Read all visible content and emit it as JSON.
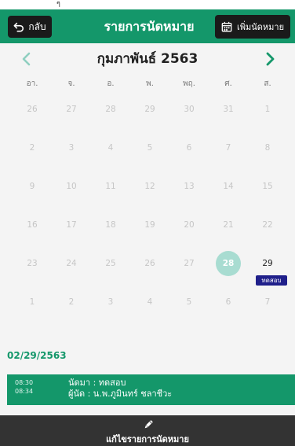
{
  "status": {
    "mark": "ๆ"
  },
  "header": {
    "back_label": "กลับ",
    "title": "รายการนัดหมาย",
    "add_label": "เพิ่มนัดหมาย"
  },
  "calendar": {
    "month_title": "กุมภาพันธ์ 2563",
    "weekdays": [
      "อา.",
      "จ.",
      "อ.",
      "พ.",
      "พฤ.",
      "ศ.",
      "ส."
    ],
    "weeks": [
      [
        {
          "d": "26",
          "active": false
        },
        {
          "d": "27",
          "active": false
        },
        {
          "d": "28",
          "active": false
        },
        {
          "d": "29",
          "active": false
        },
        {
          "d": "30",
          "active": false
        },
        {
          "d": "31",
          "active": false
        },
        {
          "d": "1",
          "active": false
        }
      ],
      [
        {
          "d": "2",
          "active": false
        },
        {
          "d": "3",
          "active": false
        },
        {
          "d": "4",
          "active": false
        },
        {
          "d": "5",
          "active": false
        },
        {
          "d": "6",
          "active": false
        },
        {
          "d": "7",
          "active": false
        },
        {
          "d": "8",
          "active": false
        }
      ],
      [
        {
          "d": "9",
          "active": false
        },
        {
          "d": "10",
          "active": false
        },
        {
          "d": "11",
          "active": false
        },
        {
          "d": "12",
          "active": false
        },
        {
          "d": "13",
          "active": false
        },
        {
          "d": "14",
          "active": false
        },
        {
          "d": "15",
          "active": false
        }
      ],
      [
        {
          "d": "16",
          "active": false
        },
        {
          "d": "17",
          "active": false
        },
        {
          "d": "18",
          "active": false
        },
        {
          "d": "19",
          "active": false
        },
        {
          "d": "20",
          "active": false
        },
        {
          "d": "21",
          "active": false
        },
        {
          "d": "22",
          "active": false
        }
      ],
      [
        {
          "d": "23",
          "active": false
        },
        {
          "d": "24",
          "active": false
        },
        {
          "d": "25",
          "active": false
        },
        {
          "d": "26",
          "active": false
        },
        {
          "d": "27",
          "active": false
        },
        {
          "d": "28",
          "active": true,
          "selected": true
        },
        {
          "d": "29",
          "active": true,
          "event": "ทดสอบ"
        }
      ],
      [
        {
          "d": "1",
          "active": false
        },
        {
          "d": "2",
          "active": false
        },
        {
          "d": "3",
          "active": false
        },
        {
          "d": "4",
          "active": false
        },
        {
          "d": "5",
          "active": false
        },
        {
          "d": "6",
          "active": false
        },
        {
          "d": "7",
          "active": false
        }
      ]
    ]
  },
  "selected_date": "02/29/2563",
  "appointment": {
    "start": "08:30",
    "end": "08:34",
    "title": "นัดมา : ทดสอบ",
    "owner": "ผู้นัด : น.พ.ภูมินทร์ ชลาชีวะ"
  },
  "footer": {
    "label": "แก้ไขรายการนัดหมาย"
  },
  "colors": {
    "primary": "#14976a",
    "dark_button": "#1a1a1a",
    "selected_day": "#a8dcd1",
    "event_badge": "#1f1f8a",
    "footer": "#333333"
  },
  "icons": {
    "back": "undo-arrow-icon",
    "add": "calendar-icon",
    "prev": "chevron-left-icon",
    "next": "chevron-right-icon",
    "edit": "pencil-icon"
  }
}
